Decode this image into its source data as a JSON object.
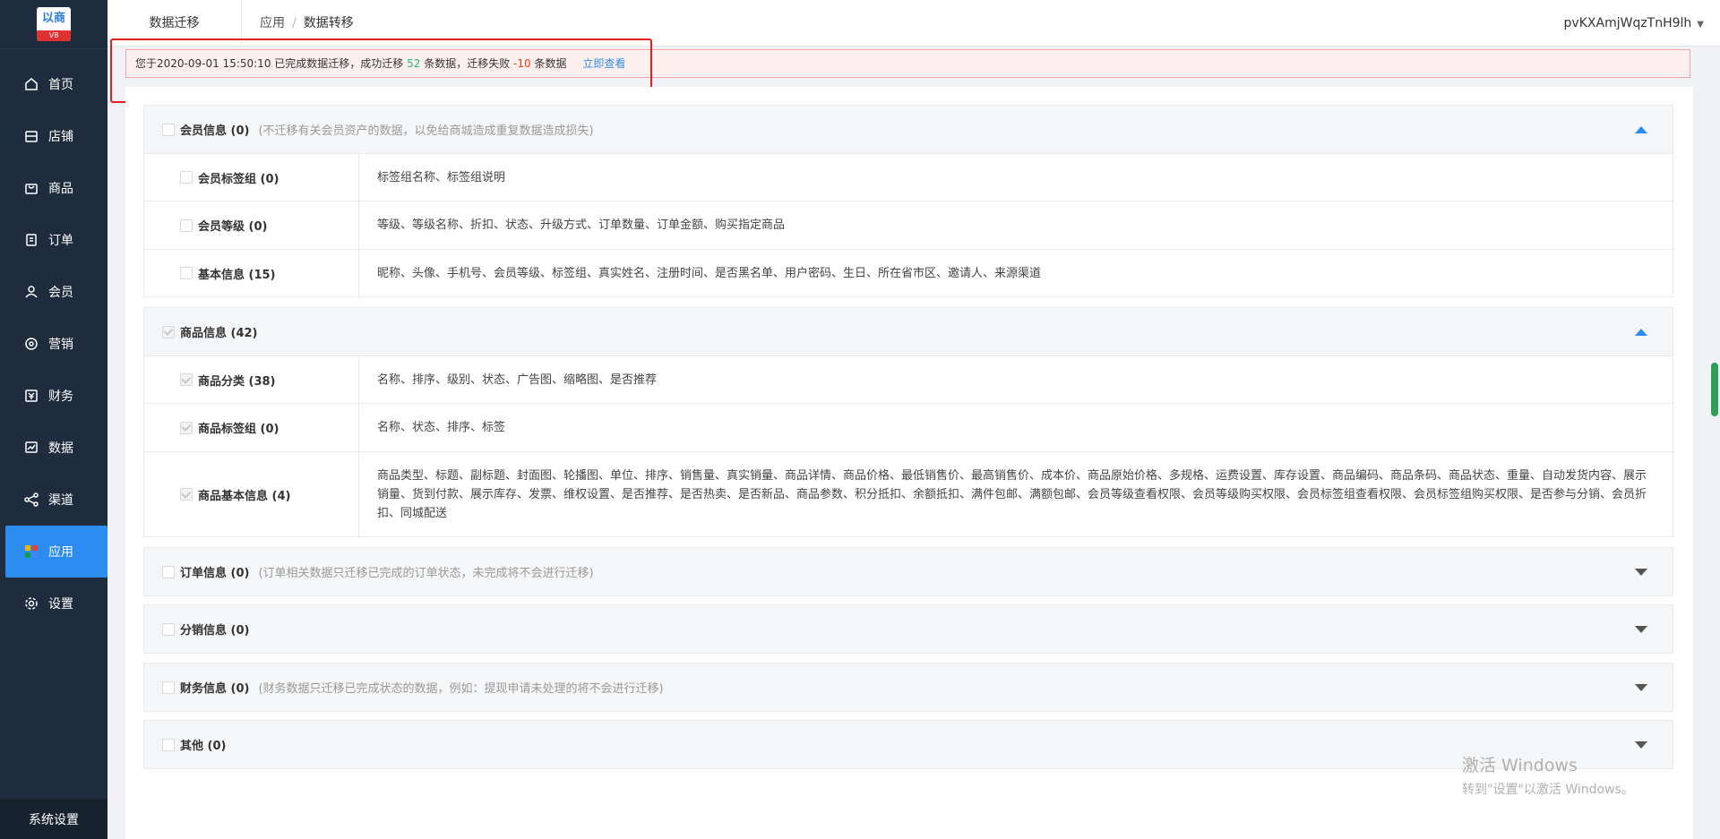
{
  "sidebar": {
    "logo": {
      "top": "以商",
      "band": "V8"
    },
    "items": [
      {
        "label": "首页",
        "icon": "home-icon"
      },
      {
        "label": "店铺",
        "icon": "store-icon"
      },
      {
        "label": "商品",
        "icon": "bag-icon"
      },
      {
        "label": "订单",
        "icon": "order-icon"
      },
      {
        "label": "会员",
        "icon": "user-icon"
      },
      {
        "label": "营销",
        "icon": "marketing-icon"
      },
      {
        "label": "财务",
        "icon": "finance-icon"
      },
      {
        "label": "数据",
        "icon": "chart-icon"
      },
      {
        "label": "渠道",
        "icon": "share-icon"
      },
      {
        "label": "应用",
        "icon": "apps-icon"
      },
      {
        "label": "设置",
        "icon": "gear-icon"
      }
    ],
    "active_index": 9,
    "system_settings": "系统设置"
  },
  "header": {
    "title": "数据迁移",
    "breadcrumb": [
      "应用",
      "数据转移"
    ],
    "user": "pvKXAmjWqzTnH9lh"
  },
  "alert": {
    "prefix": "您于2020-09-01 15:50:10 已完成数据迁移，成功迁移",
    "success_count": "52",
    "mid": "条数据，迁移失败",
    "fail_count": "-10",
    "suffix": "条数据",
    "link": "立即查看"
  },
  "sections": [
    {
      "title": "会员信息 (0)",
      "note": "(不迁移有关会员资产的数据，以免给商城造成重复数据造成损失)",
      "expanded": true,
      "checked": false,
      "rows": [
        {
          "label": "会员标签组 (0)",
          "checked": false,
          "desc": "标签组名称、标签组说明"
        },
        {
          "label": "会员等级 (0)",
          "checked": false,
          "desc": "等级、等级名称、折扣、状态、升级方式、订单数量、订单金额、购买指定商品"
        },
        {
          "label": "基本信息 (15)",
          "checked": false,
          "desc": "昵称、头像、手机号、会员等级、标签组、真实姓名、注册时间、是否黑名单、用户密码、生日、所在省市区、邀请人、来源渠道"
        }
      ]
    },
    {
      "title": "商品信息 (42)",
      "note": "",
      "expanded": true,
      "checked": true,
      "rows": [
        {
          "label": "商品分类 (38)",
          "checked": true,
          "desc": "名称、排序、级别、状态、广告图、缩略图、是否推荐"
        },
        {
          "label": "商品标签组 (0)",
          "checked": true,
          "desc": "名称、状态、排序、标签"
        },
        {
          "label": "商品基本信息 (4)",
          "checked": true,
          "desc": "商品类型、标题、副标题、封面图、轮播图、单位、排序、销售量、真实销量、商品详情、商品价格、最低销售价、最高销售价、成本价、商品原始价格、多规格、运费设置、库存设置、商品编码、商品条码、商品状态、重量、自动发货内容、展示销量、货到付款、展示库存、发票、维权设置、是否推荐、是否热卖、是否新品、商品参数、积分抵扣、余额抵扣、满件包邮、满额包邮、会员等级查看权限、会员等级购买权限、会员标签组查看权限、会员标签组购买权限、是否参与分销、会员折扣、同城配送"
        }
      ]
    },
    {
      "title": "订单信息 (0)",
      "note": "(订单相关数据只迁移已完成的订单状态，未完成将不会进行迁移)",
      "expanded": false,
      "checked": false,
      "rows": []
    },
    {
      "title": "分销信息 (0)",
      "note": "",
      "expanded": false,
      "checked": false,
      "rows": []
    },
    {
      "title": "财务信息 (0)",
      "note": "(财务数据只迁移已完成状态的数据，例如：提现申请未处理的将不会进行迁移)",
      "expanded": false,
      "checked": false,
      "rows": []
    },
    {
      "title": "其他 (0)",
      "note": "",
      "expanded": false,
      "checked": false,
      "rows": []
    }
  ],
  "watermark": {
    "line1": "激活 Windows",
    "line2": "转到\"设置\"以激活 Windows。"
  },
  "colors": {
    "sidebar_bg": "#1e2c3e",
    "accent": "#2d8cf0",
    "success": "#19be6b",
    "danger": "#ed4014"
  }
}
